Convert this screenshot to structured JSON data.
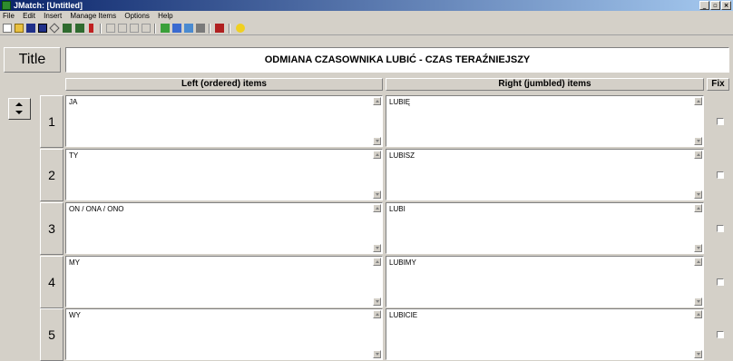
{
  "window": {
    "title": "JMatch: [Untitled]"
  },
  "menu": {
    "items": [
      "File",
      "Edit",
      "Insert",
      "Manage Items",
      "Options",
      "Help"
    ]
  },
  "toolbar": {
    "icons": [
      "new-file-icon",
      "open-folder-icon",
      "save-icon",
      "save-as-icon",
      "diamond-icon",
      "export-web-icon",
      "export-alt-icon",
      "pin-icon",
      "undo-icon",
      "cut-icon",
      "copy-icon",
      "paste-icon",
      "config-icon",
      "hotpot-icon",
      "globe-icon",
      "tools-icon",
      "hat-icon",
      "help-icon"
    ]
  },
  "title_row": {
    "label": "Title",
    "value": "ODMIANA CZASOWNIKA LUBIĆ - CZAS TERAŹNIEJSZY"
  },
  "headers": {
    "left": "Left (ordered) items",
    "right": "Right (jumbled) items",
    "fix": "Fix"
  },
  "rows": [
    {
      "num": "1",
      "left": "JA",
      "right": "LUBIĘ"
    },
    {
      "num": "2",
      "left": "TY",
      "right": "LUBISZ"
    },
    {
      "num": "3",
      "left": "ON / ONA / ONO",
      "right": "LUBI"
    },
    {
      "num": "4",
      "left": "MY",
      "right": "LUBIMY"
    },
    {
      "num": "5",
      "left": "WY",
      "right": "LUBICIE"
    }
  ]
}
